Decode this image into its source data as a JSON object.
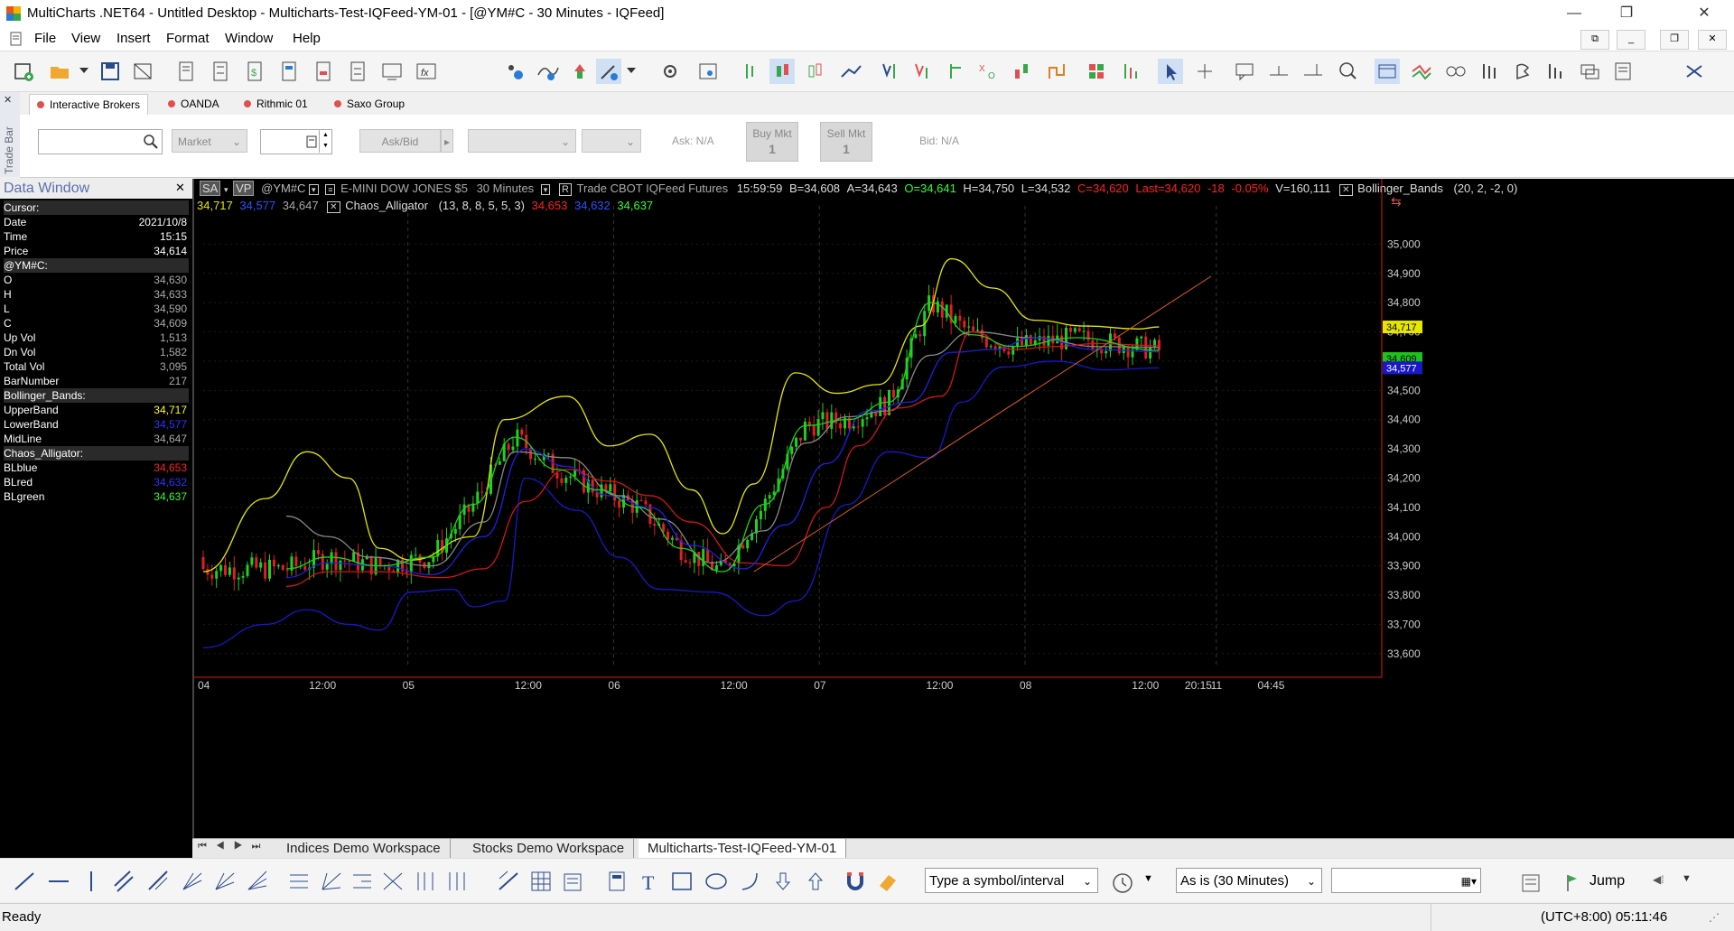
{
  "window": {
    "title": "MultiCharts .NET64 - Untitled Desktop - Multicharts-Test-IQFeed-YM-01 - [@YM#C - 30 Minutes - IQFeed]",
    "minimize": "—",
    "restore": "❐",
    "close": "✕"
  },
  "menu": {
    "items": [
      "File",
      "View",
      "Insert",
      "Format",
      "Window",
      "Help"
    ]
  },
  "broker_tabs": [
    "Interactive Brokers",
    "OANDA",
    "Rithmic 01",
    "Saxo Group"
  ],
  "tradebar": {
    "side_label": "Trade Bar",
    "order_type": "Market",
    "ask_bid": "Ask/Bid",
    "buy_label": "Buy Mkt",
    "buy_qty": "1",
    "sell_label": "Sell Mkt",
    "sell_qty": "1",
    "ask": "Ask: N/A",
    "bid": "Bid: N/A"
  },
  "data_window": {
    "title": "Data Window",
    "rows": [
      {
        "label": "Cursor:",
        "value": "",
        "section": true
      },
      {
        "label": "Date",
        "value": "2021/10/8",
        "color": "#ffffff"
      },
      {
        "label": "Time",
        "value": "15:15",
        "color": "#ffffff"
      },
      {
        "label": "Price",
        "value": "34,614",
        "color": "#ffffff"
      },
      {
        "label": "@YM#C:",
        "value": "",
        "section": true
      },
      {
        "label": "O",
        "value": "34,630",
        "color": "#aaaaaa"
      },
      {
        "label": "H",
        "value": "34,633",
        "color": "#aaaaaa"
      },
      {
        "label": "L",
        "value": "34,590",
        "color": "#aaaaaa"
      },
      {
        "label": "C",
        "value": "34,609",
        "color": "#aaaaaa"
      },
      {
        "label": "Up Vol",
        "value": "1,513",
        "color": "#aaaaaa"
      },
      {
        "label": "Dn Vol",
        "value": "1,582",
        "color": "#aaaaaa"
      },
      {
        "label": "Total Vol",
        "value": "3,095",
        "color": "#aaaaaa"
      },
      {
        "label": "BarNumber",
        "value": "217",
        "color": "#aaaaaa"
      },
      {
        "label": "Bollinger_Bands:",
        "value": "",
        "section": true
      },
      {
        "label": "UpperBand",
        "value": "34,717",
        "color": "#ffff00"
      },
      {
        "label": "LowerBand",
        "value": "34,577",
        "color": "#3030ff"
      },
      {
        "label": "MidLine",
        "value": "34,647",
        "color": "#aaaaaa"
      },
      {
        "label": "Chaos_Alligator:",
        "value": "",
        "section": true
      },
      {
        "label": "BLblue",
        "value": "34,653",
        "color": "#ff2020"
      },
      {
        "label": "BLred",
        "value": "34,632",
        "color": "#3030ff"
      },
      {
        "label": "BLgreen",
        "value": "34,637",
        "color": "#30ff30"
      }
    ]
  },
  "chart_header": {
    "sa": "SA",
    "vp": "VP",
    "symbol": "@YM#C",
    "description": "E-MINI DOW JONES $5",
    "interval": "30 Minutes",
    "r": "R",
    "source": "Trade  CBOT  IQFeed  Futures",
    "time": "15:59:59",
    "b": "B=34,608",
    "a": "A=34,643",
    "o": "O=34,641",
    "h": "H=34,750",
    "l": "L=34,532",
    "c": "C=34,620",
    "last": "Last=34,620",
    "chg": "-18",
    "pct": "-0.05%",
    "vol": "V=160,111",
    "bb_name": "Bollinger_Bands",
    "bb_params": "(20,  2,  -2,  0)",
    "bb_v1": "34,717",
    "bb_v2": "34,577",
    "bb_v3": "34,647",
    "ca_name": "Chaos_Alligator",
    "ca_params": "(13,  8,  8,  5,  5,  3)",
    "ca_v1": "34,653",
    "ca_v2": "34,632",
    "ca_v3": "34,637"
  },
  "chart_data": {
    "type": "candlestick",
    "symbol": "@YM#C",
    "interval": "30 Minutes",
    "ylim": [
      33550,
      35100
    ],
    "y_ticks": [
      "35,000",
      "34,900",
      "34,800",
      "34,700",
      "34,600",
      "34,500",
      "34,400",
      "34,300",
      "34,200",
      "34,100",
      "34,000",
      "33,900",
      "33,800",
      "33,700",
      "33,600"
    ],
    "y_tick_values": [
      35000,
      34900,
      34800,
      34700,
      34600,
      34500,
      34400,
      34300,
      34200,
      34100,
      34000,
      33900,
      33800,
      33700,
      33600
    ],
    "x_labels": [
      {
        "label": "04",
        "x": 0.0
      },
      {
        "label": "12:00",
        "x": 0.107
      },
      {
        "label": "05",
        "x": 0.197
      },
      {
        "label": "12:00",
        "x": 0.305
      },
      {
        "label": "06",
        "x": 0.395
      },
      {
        "label": "12:00",
        "x": 0.503
      },
      {
        "label": "07",
        "x": 0.593
      },
      {
        "label": "12:00",
        "x": 0.701
      },
      {
        "label": "08",
        "x": 0.791
      },
      {
        "label": "12:00",
        "x": 0.899
      },
      {
        "label": "20:15",
        "x": 0.95
      },
      {
        "label": "11",
        "x": 0.975
      },
      {
        "label": "04:45",
        "x": 1.02
      }
    ],
    "x_span": [
      0,
      1.13
    ],
    "series": [
      {
        "name": "BollingerUpper",
        "color": "#e6e600",
        "points": [
          [
            0,
            33880
          ],
          [
            0.06,
            34130
          ],
          [
            0.1,
            34290
          ],
          [
            0.14,
            34200
          ],
          [
            0.17,
            33960
          ],
          [
            0.2,
            33920
          ],
          [
            0.26,
            34000
          ],
          [
            0.29,
            34400
          ],
          [
            0.35,
            34480
          ],
          [
            0.39,
            34310
          ],
          [
            0.43,
            34350
          ],
          [
            0.47,
            34160
          ],
          [
            0.5,
            34010
          ],
          [
            0.53,
            34180
          ],
          [
            0.57,
            34560
          ],
          [
            0.61,
            34490
          ],
          [
            0.65,
            34520
          ],
          [
            0.69,
            34720
          ],
          [
            0.72,
            34950
          ],
          [
            0.76,
            34850
          ],
          [
            0.8,
            34740
          ],
          [
            0.85,
            34720
          ],
          [
            0.9,
            34710
          ],
          [
            0.92,
            34717
          ]
        ]
      },
      {
        "name": "BollingerLower",
        "color": "#1818c8",
        "points": [
          [
            0,
            33620
          ],
          [
            0.06,
            33700
          ],
          [
            0.1,
            33750
          ],
          [
            0.14,
            33700
          ],
          [
            0.17,
            33680
          ],
          [
            0.2,
            33810
          ],
          [
            0.24,
            33820
          ],
          [
            0.26,
            33760
          ],
          [
            0.29,
            33780
          ],
          [
            0.31,
            34200
          ],
          [
            0.36,
            34090
          ],
          [
            0.4,
            33930
          ],
          [
            0.44,
            33820
          ],
          [
            0.49,
            33810
          ],
          [
            0.54,
            33730
          ],
          [
            0.57,
            33780
          ],
          [
            0.62,
            34110
          ],
          [
            0.66,
            34290
          ],
          [
            0.7,
            34270
          ],
          [
            0.73,
            34460
          ],
          [
            0.77,
            34580
          ],
          [
            0.82,
            34600
          ],
          [
            0.87,
            34570
          ],
          [
            0.92,
            34577
          ]
        ]
      },
      {
        "name": "BollingerMid",
        "color": "#888888",
        "points": [
          [
            0.08,
            34070
          ],
          [
            0.12,
            34000
          ],
          [
            0.16,
            33930
          ],
          [
            0.22,
            33900
          ],
          [
            0.27,
            34050
          ],
          [
            0.3,
            34290
          ],
          [
            0.35,
            34270
          ],
          [
            0.4,
            34140
          ],
          [
            0.44,
            34060
          ],
          [
            0.49,
            33910
          ],
          [
            0.54,
            34020
          ],
          [
            0.58,
            34320
          ],
          [
            0.62,
            34410
          ],
          [
            0.66,
            34430
          ],
          [
            0.7,
            34620
          ],
          [
            0.74,
            34700
          ],
          [
            0.8,
            34680
          ],
          [
            0.86,
            34650
          ],
          [
            0.92,
            34647
          ]
        ]
      },
      {
        "name": "AlligatorJaw",
        "color": "#d01818",
        "points": [
          [
            0.08,
            33830
          ],
          [
            0.12,
            33880
          ],
          [
            0.17,
            33880
          ],
          [
            0.23,
            33860
          ],
          [
            0.27,
            33890
          ],
          [
            0.31,
            34120
          ],
          [
            0.35,
            34230
          ],
          [
            0.39,
            34190
          ],
          [
            0.43,
            34140
          ],
          [
            0.47,
            34050
          ],
          [
            0.52,
            33910
          ],
          [
            0.56,
            33900
          ],
          [
            0.6,
            34100
          ],
          [
            0.63,
            34310
          ],
          [
            0.67,
            34440
          ],
          [
            0.71,
            34480
          ],
          [
            0.74,
            34700
          ],
          [
            0.78,
            34640
          ],
          [
            0.82,
            34650
          ],
          [
            0.86,
            34660
          ],
          [
            0.92,
            34653
          ]
        ]
      },
      {
        "name": "AlligatorTeeth",
        "color": "#2020e0",
        "points": [
          [
            0.08,
            33860
          ],
          [
            0.12,
            33910
          ],
          [
            0.17,
            33900
          ],
          [
            0.22,
            33870
          ],
          [
            0.27,
            34000
          ],
          [
            0.31,
            34300
          ],
          [
            0.35,
            34240
          ],
          [
            0.39,
            34140
          ],
          [
            0.43,
            34100
          ],
          [
            0.47,
            33970
          ],
          [
            0.52,
            33890
          ],
          [
            0.56,
            34040
          ],
          [
            0.6,
            34250
          ],
          [
            0.64,
            34430
          ],
          [
            0.68,
            34460
          ],
          [
            0.72,
            34630
          ],
          [
            0.76,
            34640
          ],
          [
            0.8,
            34680
          ],
          [
            0.86,
            34640
          ],
          [
            0.92,
            34632
          ]
        ]
      },
      {
        "name": "AlligatorLips",
        "color": "#20d020",
        "points": [
          [
            0.08,
            33890
          ],
          [
            0.12,
            33930
          ],
          [
            0.17,
            33900
          ],
          [
            0.22,
            33930
          ],
          [
            0.26,
            34110
          ],
          [
            0.3,
            34340
          ],
          [
            0.34,
            34230
          ],
          [
            0.38,
            34160
          ],
          [
            0.42,
            34100
          ],
          [
            0.46,
            33960
          ],
          [
            0.5,
            33880
          ],
          [
            0.54,
            34110
          ],
          [
            0.58,
            34380
          ],
          [
            0.62,
            34400
          ],
          [
            0.66,
            34460
          ],
          [
            0.7,
            34800
          ],
          [
            0.74,
            34690
          ],
          [
            0.78,
            34650
          ],
          [
            0.84,
            34680
          ],
          [
            0.92,
            34637
          ]
        ]
      }
    ],
    "trendline": {
      "color": "#e06020",
      "points": [
        [
          0.53,
          33880
        ],
        [
          0.97,
          34890
        ]
      ]
    },
    "price_markers": [
      {
        "value": "34,717",
        "y": 34717,
        "bg": "#e6e600",
        "fg": "#000000"
      },
      {
        "value": "34,609",
        "y": 34609,
        "bg": "#20c020",
        "fg": "#000000"
      },
      {
        "value": "34,577",
        "y": 34577,
        "bg": "#1818c8",
        "fg": "#ffffff"
      }
    ]
  },
  "workspace_tabs": [
    "Indices Demo Workspace",
    "Stocks Demo Workspace",
    "Multicharts-Test-IQFeed-YM-01"
  ],
  "active_workspace": 2,
  "drawbar": {
    "symbol_placeholder": "Type a symbol/interval",
    "interval_value": "As is (30 Minutes)",
    "jump": "Jump"
  },
  "status": {
    "left": "Ready",
    "clock": "(UTC+8:00) 05:11:46"
  }
}
